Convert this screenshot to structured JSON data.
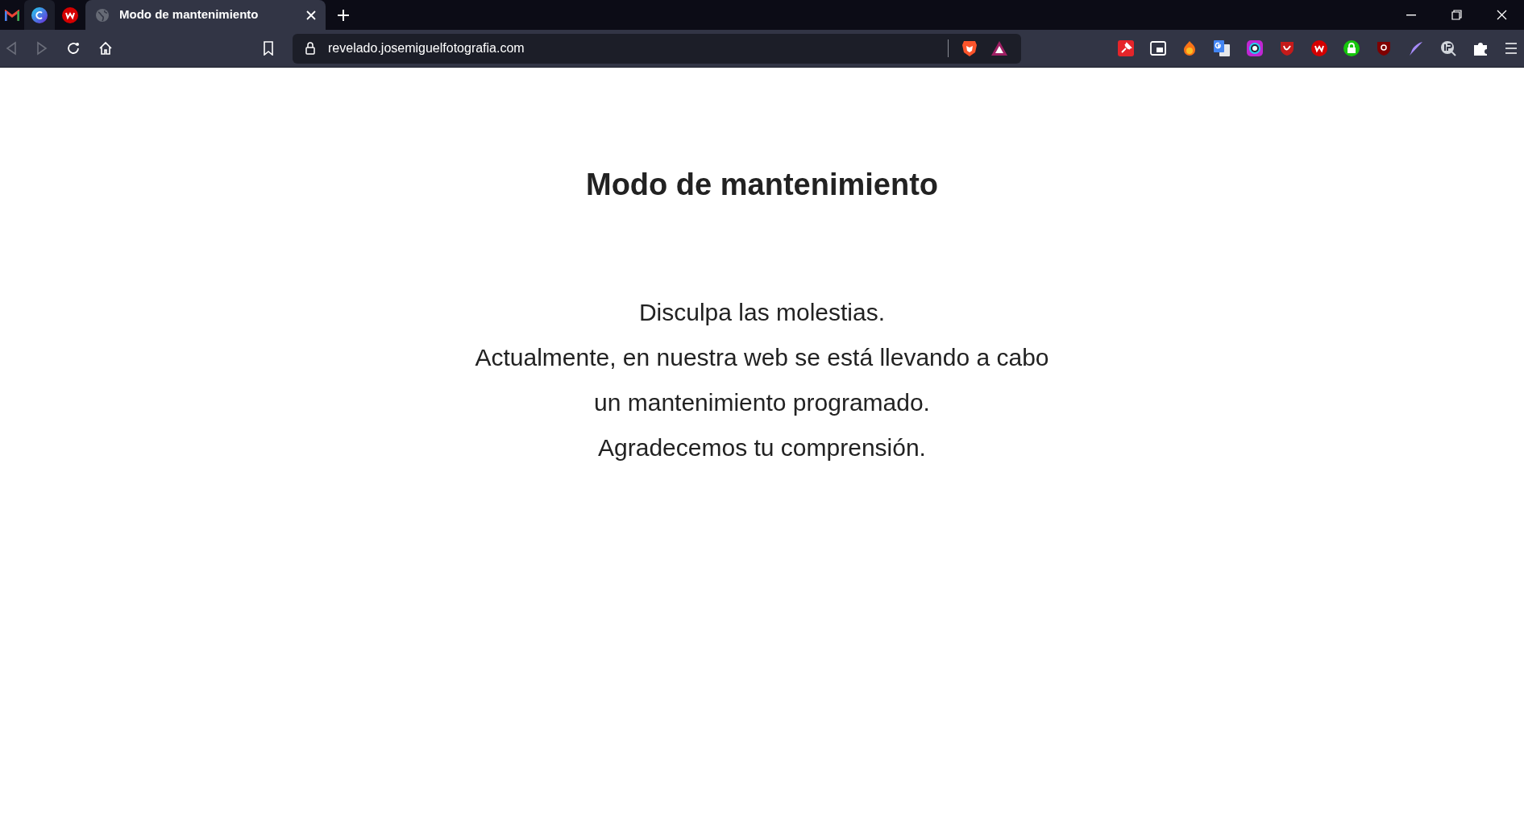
{
  "browser": {
    "tab": {
      "title": "Modo de mantenimiento",
      "selected": true
    },
    "address": "revelado.josemiguelfotografia.com"
  },
  "page": {
    "heading": "Modo de mantenimiento",
    "lines": [
      "Disculpa las molestias.",
      "Actualmente, en nuestra web se está llevando a cabo",
      "un mantenimiento programado.",
      "Agradecemos tu comprensión."
    ]
  }
}
